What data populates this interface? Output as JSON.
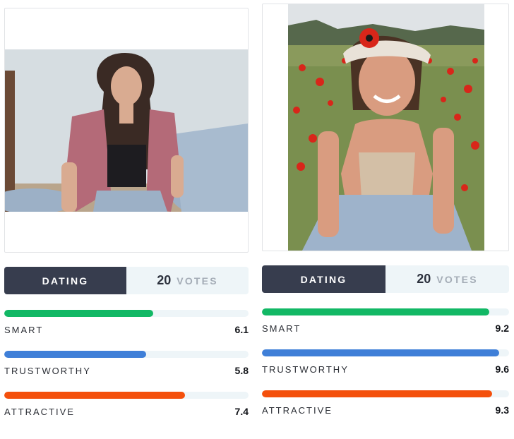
{
  "cards": [
    {
      "id": "left",
      "photo": {
        "subject": "woman in pink fur vest sitting against pale blue wall",
        "colors": {
          "wall": "#cfd7dc",
          "floor": "#b9a58c",
          "skin": "#d9ab91",
          "hair": "#3a2a24",
          "vest": "#b46a78",
          "top": "#1d1c20",
          "jeans": "#9cb0c6"
        }
      },
      "mode_label": "DATING",
      "votes": {
        "count": "20",
        "label": "VOTES"
      },
      "metrics": [
        {
          "label": "SMART",
          "value": "6.1",
          "fraction": 0.61,
          "color": "#12b865"
        },
        {
          "label": "TRUSTWORTHY",
          "value": "5.8",
          "fraction": 0.58,
          "color": "#3f7fd8"
        },
        {
          "label": "ATTRACTIVE",
          "value": "7.4",
          "fraction": 0.74,
          "color": "#f4500c"
        }
      ]
    },
    {
      "id": "right",
      "photo": {
        "subject": "smiling woman with visor sitting in a field of red poppies",
        "colors": {
          "sky": "#dfe3e6",
          "trees": "#56684c",
          "field": "#7a8f4f",
          "poppy": "#d8261a",
          "skin": "#d99c80",
          "visor": "#e9e2d8",
          "top": "#d3bfa6",
          "jeans": "#9eb3cb",
          "hair": "#4a3224"
        }
      },
      "mode_label": "DATING",
      "votes": {
        "count": "20",
        "label": "VOTES"
      },
      "metrics": [
        {
          "label": "SMART",
          "value": "9.2",
          "fraction": 0.92,
          "color": "#12b865"
        },
        {
          "label": "TRUSTWORTHY",
          "value": "9.6",
          "fraction": 0.96,
          "color": "#3f7fd8"
        },
        {
          "label": "ATTRACTIVE",
          "value": "9.3",
          "fraction": 0.93,
          "color": "#f4500c"
        }
      ]
    }
  ]
}
